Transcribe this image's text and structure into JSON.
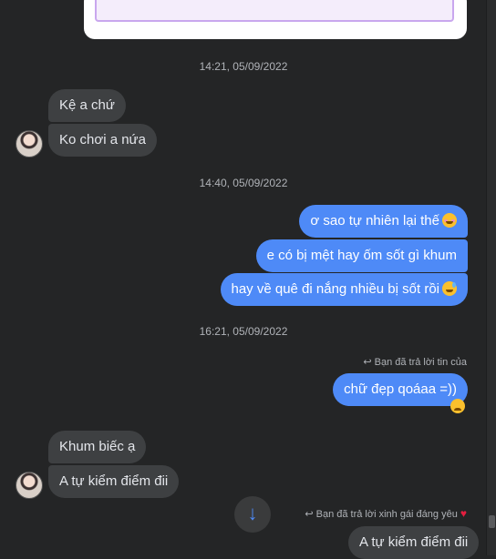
{
  "timestamps": [
    "14:21, 05/09/2022",
    "14:40, 05/09/2022",
    "16:21, 05/09/2022"
  ],
  "messages": {
    "m1": "Kệ a chứ",
    "m2": "Ko chơi a nứa",
    "m3": "ơ sao tự nhiên lại thế",
    "m4": "e có bị mệt hay ốm sốt gì khum",
    "m5": "hay về quê đi nắng nhiều bị sốt rồi",
    "m6": "chữ đẹp qoáaa =))",
    "m7": "Khum biếc ạ",
    "m8": "A tự kiểm điểm đii",
    "m9": "A tự kiểm điểm đii"
  },
  "reply_notes": {
    "r1": "Bạn đã trả lời tin của",
    "r2": "Bạn đã trả lời xinh gái đáng yêu"
  },
  "icons": {
    "reply": "reply-icon",
    "heart": "heart-icon",
    "scroll_down": "arrow-down-icon"
  },
  "colors": {
    "outgoing": "#4e8af7",
    "incoming": "#3e4042",
    "background": "#242526"
  }
}
